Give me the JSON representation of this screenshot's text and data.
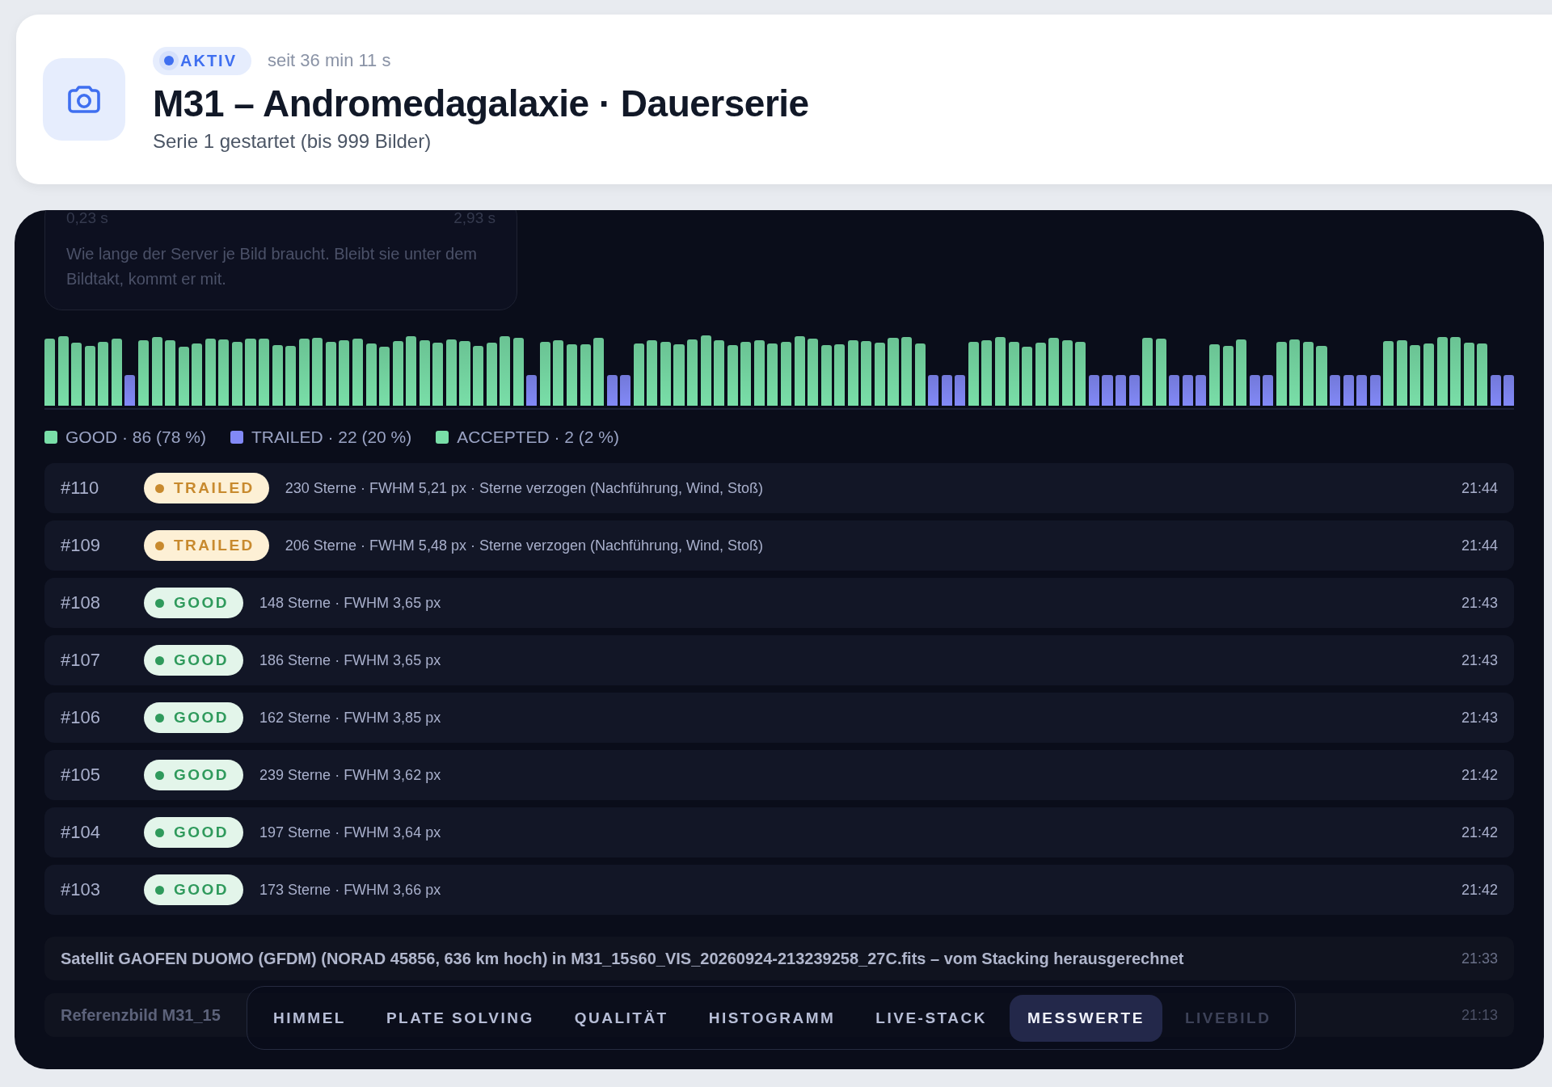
{
  "header": {
    "status": {
      "label": "AKTIV",
      "active": true
    },
    "since": "seit 36 min 11 s",
    "title": "M31 – Andromedagalaxie · Dauerserie",
    "subtitle": "Serie 1 gestartet (bis 999 Bilder)"
  },
  "timing_card": {
    "min_label": "0,23 s",
    "max_label": "2,93 s",
    "description": "Wie lange der Server je Bild braucht. Bleibt sie unter dem Bildtakt, kommt er mit."
  },
  "frames": [
    {
      "kind": "good"
    },
    {
      "kind": "good"
    },
    {
      "kind": "good"
    },
    {
      "kind": "good"
    },
    {
      "kind": "good"
    },
    {
      "kind": "good"
    },
    {
      "kind": "trailed"
    },
    {
      "kind": "good"
    },
    {
      "kind": "good"
    },
    {
      "kind": "good"
    },
    {
      "kind": "good"
    },
    {
      "kind": "good"
    },
    {
      "kind": "good"
    },
    {
      "kind": "good"
    },
    {
      "kind": "good"
    },
    {
      "kind": "good"
    },
    {
      "kind": "good"
    },
    {
      "kind": "good"
    },
    {
      "kind": "good"
    },
    {
      "kind": "good"
    },
    {
      "kind": "good"
    },
    {
      "kind": "good"
    },
    {
      "kind": "good"
    },
    {
      "kind": "good"
    },
    {
      "kind": "good"
    },
    {
      "kind": "good"
    },
    {
      "kind": "good"
    },
    {
      "kind": "good"
    },
    {
      "kind": "good"
    },
    {
      "kind": "good"
    },
    {
      "kind": "good"
    },
    {
      "kind": "good"
    },
    {
      "kind": "good"
    },
    {
      "kind": "good"
    },
    {
      "kind": "good"
    },
    {
      "kind": "good"
    },
    {
      "kind": "trailed"
    },
    {
      "kind": "good"
    },
    {
      "kind": "good"
    },
    {
      "kind": "good"
    },
    {
      "kind": "good"
    },
    {
      "kind": "good"
    },
    {
      "kind": "trailed"
    },
    {
      "kind": "trailed"
    },
    {
      "kind": "good"
    },
    {
      "kind": "good"
    },
    {
      "kind": "good"
    },
    {
      "kind": "good"
    },
    {
      "kind": "good"
    },
    {
      "kind": "good"
    },
    {
      "kind": "good"
    },
    {
      "kind": "good"
    },
    {
      "kind": "good"
    },
    {
      "kind": "good"
    },
    {
      "kind": "good"
    },
    {
      "kind": "good"
    },
    {
      "kind": "good"
    },
    {
      "kind": "good"
    },
    {
      "kind": "good"
    },
    {
      "kind": "good"
    },
    {
      "kind": "good"
    },
    {
      "kind": "good"
    },
    {
      "kind": "good"
    },
    {
      "kind": "good"
    },
    {
      "kind": "good"
    },
    {
      "kind": "good"
    },
    {
      "kind": "trailed"
    },
    {
      "kind": "trailed"
    },
    {
      "kind": "trailed"
    },
    {
      "kind": "good"
    },
    {
      "kind": "good"
    },
    {
      "kind": "good"
    },
    {
      "kind": "good"
    },
    {
      "kind": "good"
    },
    {
      "kind": "good"
    },
    {
      "kind": "good"
    },
    {
      "kind": "good"
    },
    {
      "kind": "good"
    },
    {
      "kind": "trailed"
    },
    {
      "kind": "trailed"
    },
    {
      "kind": "trailed"
    },
    {
      "kind": "trailed"
    },
    {
      "kind": "good"
    },
    {
      "kind": "good"
    },
    {
      "kind": "trailed"
    },
    {
      "kind": "trailed"
    },
    {
      "kind": "trailed"
    },
    {
      "kind": "good"
    },
    {
      "kind": "good"
    },
    {
      "kind": "good"
    },
    {
      "kind": "trailed"
    },
    {
      "kind": "trailed"
    },
    {
      "kind": "good"
    },
    {
      "kind": "good"
    },
    {
      "kind": "good"
    },
    {
      "kind": "good"
    },
    {
      "kind": "trailed"
    },
    {
      "kind": "trailed"
    },
    {
      "kind": "trailed"
    },
    {
      "kind": "trailed"
    },
    {
      "kind": "good"
    },
    {
      "kind": "good"
    },
    {
      "kind": "good"
    },
    {
      "kind": "good"
    },
    {
      "kind": "good"
    },
    {
      "kind": "good"
    },
    {
      "kind": "good"
    },
    {
      "kind": "good"
    },
    {
      "kind": "trailed"
    },
    {
      "kind": "trailed"
    }
  ],
  "legend": [
    {
      "label": "GOOD · 86 (78 %)",
      "color": "#79dea8"
    },
    {
      "label": "TRAILED · 22 (20 %)",
      "color": "#8289f7"
    },
    {
      "label": "ACCEPTED · 2 (2 %)",
      "color": "#79dea8"
    }
  ],
  "rows": [
    {
      "number": "#110",
      "kind": "trailed",
      "badge": "TRAILED",
      "details": "230 Sterne · FWHM 5,21 px · Sterne verzogen (Nachführung, Wind, Stoß)",
      "time": "21:44"
    },
    {
      "number": "#109",
      "kind": "trailed",
      "badge": "TRAILED",
      "details": "206 Sterne · FWHM 5,48 px · Sterne verzogen (Nachführung, Wind, Stoß)",
      "time": "21:44"
    },
    {
      "number": "#108",
      "kind": "good",
      "badge": "GOOD",
      "details": "148 Sterne · FWHM 3,65 px",
      "time": "21:43"
    },
    {
      "number": "#107",
      "kind": "good",
      "badge": "GOOD",
      "details": "186 Sterne · FWHM 3,65 px",
      "time": "21:43"
    },
    {
      "number": "#106",
      "kind": "good",
      "badge": "GOOD",
      "details": "162 Sterne · FWHM 3,85 px",
      "time": "21:43"
    },
    {
      "number": "#105",
      "kind": "good",
      "badge": "GOOD",
      "details": "239 Sterne · FWHM 3,62 px",
      "time": "21:42"
    },
    {
      "number": "#104",
      "kind": "good",
      "badge": "GOOD",
      "details": "197 Sterne · FWHM 3,64 px",
      "time": "21:42"
    },
    {
      "number": "#103",
      "kind": "good",
      "badge": "GOOD",
      "details": "173 Sterne · FWHM 3,66 px",
      "time": "21:42"
    }
  ],
  "events": [
    {
      "text": "Satellit GAOFEN DUOMO (GFDM) (NORAD 45856, 636 km hoch) in M31_15s60_VIS_20260924-213239258_27C.fits – vom Stacking herausgerechnet",
      "time": "21:33"
    },
    {
      "text": "Referenzbild M31_15",
      "time": "21:13"
    }
  ],
  "nav": [
    {
      "label": "HIMMEL",
      "selected": false,
      "disabled": false
    },
    {
      "label": "PLATE SOLVING",
      "selected": false,
      "disabled": false
    },
    {
      "label": "QUALITÄT",
      "selected": false,
      "disabled": false
    },
    {
      "label": "HISTOGRAMM",
      "selected": false,
      "disabled": false
    },
    {
      "label": "LIVE-STACK",
      "selected": false,
      "disabled": false
    },
    {
      "label": "MESSWERTE",
      "selected": true,
      "disabled": false
    },
    {
      "label": "LIVEBILD",
      "selected": false,
      "disabled": true
    }
  ]
}
